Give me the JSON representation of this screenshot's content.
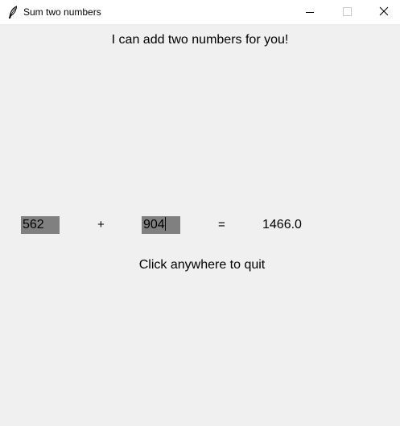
{
  "window": {
    "title": "Sum two numbers"
  },
  "main": {
    "heading": "I can add two numbers for you!",
    "first_value": "562",
    "plus_sign": "+",
    "second_value": "904",
    "equals_sign": "=",
    "result": "1466.0",
    "quit_hint": "Click anywhere to quit"
  },
  "icons": {
    "app": "feather-icon",
    "minimize": "minimize-icon",
    "maximize": "maximize-icon",
    "close": "close-icon"
  },
  "colors": {
    "window_background": "#f0f0f0",
    "titlebar_background": "#ffffff",
    "entry_background": "#808080",
    "text": "#000000"
  }
}
